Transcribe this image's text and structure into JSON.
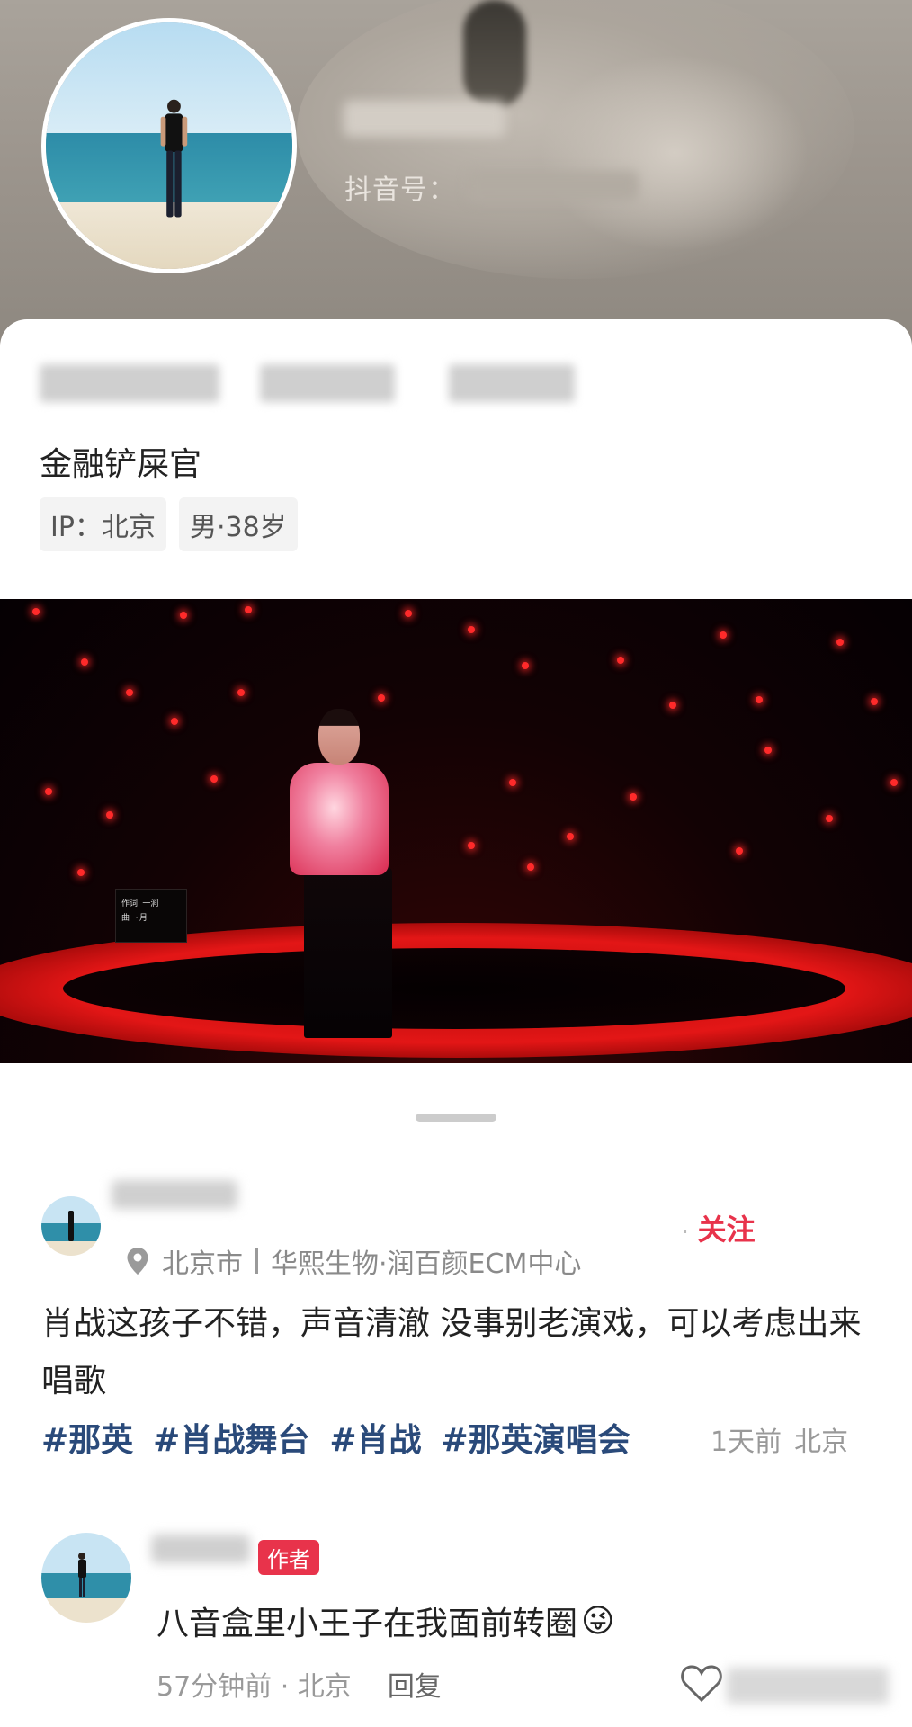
{
  "profile": {
    "douyin_id_label": "抖音号：",
    "bio": "金融铲屎官",
    "tags": [
      "IP：北京",
      "男·38岁"
    ]
  },
  "comment": {
    "follow_label": "关注",
    "location": "北京市",
    "venue": "华熙生物·润百颜ECM中心",
    "text": "肖战这孩子不错，声音清澈 没事别老演戏，可以考虑出来唱歌",
    "hashtags": [
      "#那英",
      "#肖战舞台",
      "#肖战",
      "#那英演唱会"
    ],
    "time": "1天前",
    "region": "北京"
  },
  "reply": {
    "badge": "作者",
    "text": "八音盒里小王子在我面前转圈",
    "emoji": "😜",
    "time": "57分钟前",
    "region": "· 北京",
    "reply_label": "回复"
  },
  "video": {
    "screen_line1": "作词 一涧",
    "screen_line2": "曲  ·月"
  },
  "colors": {
    "accent_red": "#e8334b",
    "hashtag_blue": "#2a4a7a"
  }
}
